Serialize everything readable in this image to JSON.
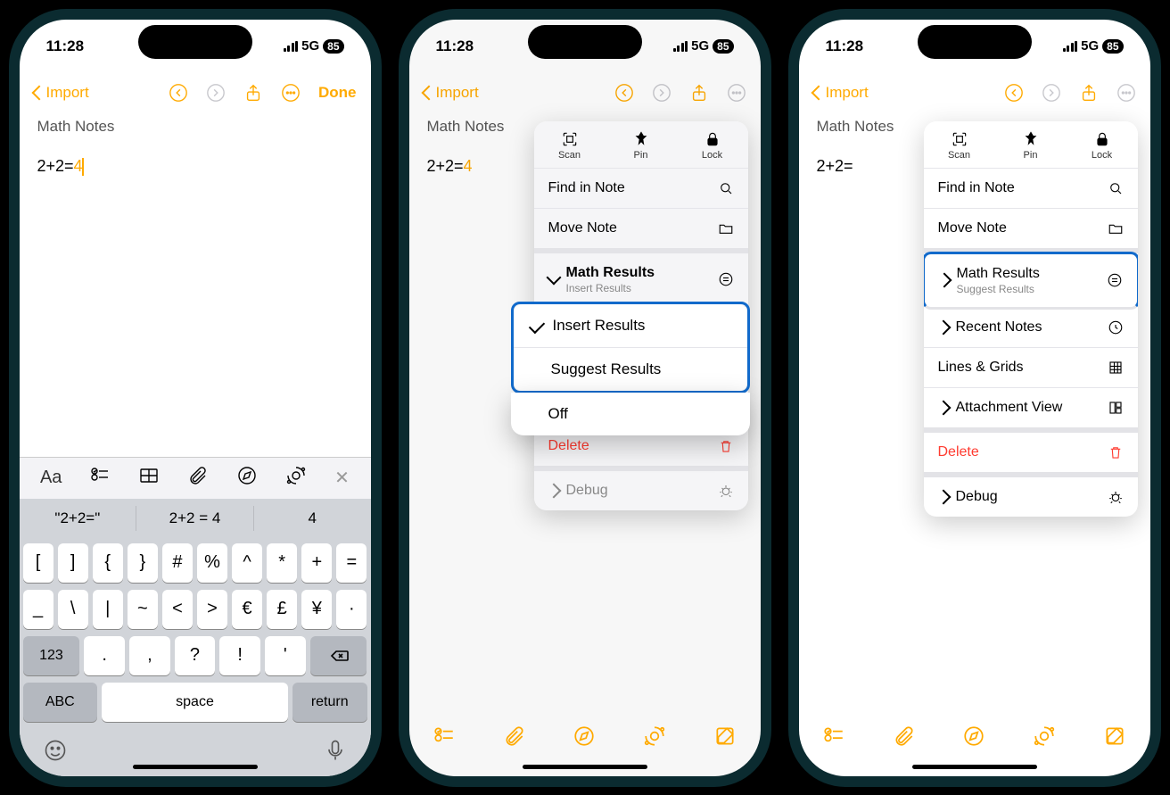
{
  "status": {
    "time": "11:28",
    "network": "5G",
    "battery": "85"
  },
  "nav": {
    "back_label": "Import",
    "done_label": "Done"
  },
  "note": {
    "title": "Math Notes",
    "equation_left": "2+2=",
    "equation_result": "4"
  },
  "keyboard": {
    "aa_label": "Aa",
    "suggestions": [
      "\"2+2=\"",
      "2+2 = 4",
      "4"
    ],
    "row1": [
      "[",
      "]",
      "{",
      "}",
      "#",
      "%",
      "^",
      "*",
      "+",
      "="
    ],
    "row2": [
      "_",
      "\\",
      "|",
      "~",
      "<",
      ">",
      "€",
      "£",
      "¥",
      "·"
    ],
    "key123": "123",
    "row3": [
      ".",
      ",",
      "?",
      "!",
      "'"
    ],
    "abc": "ABC",
    "space": "space",
    "return": "return"
  },
  "menu_top": {
    "scan": "Scan",
    "pin": "Pin",
    "lock": "Lock"
  },
  "menu_common": {
    "find": "Find in Note",
    "move": "Move Note",
    "math_results": "Math Results",
    "insert_results": "Insert Results",
    "suggest_results": "Suggest Results",
    "off": "Off",
    "recent": "Recent Notes",
    "lines_grids": "Lines & Grids",
    "attachment_view": "Attachment View",
    "delete": "Delete",
    "debug": "Debug"
  },
  "phone2_math_sub": "Insert Results",
  "phone3_math_sub": "Suggest Results"
}
